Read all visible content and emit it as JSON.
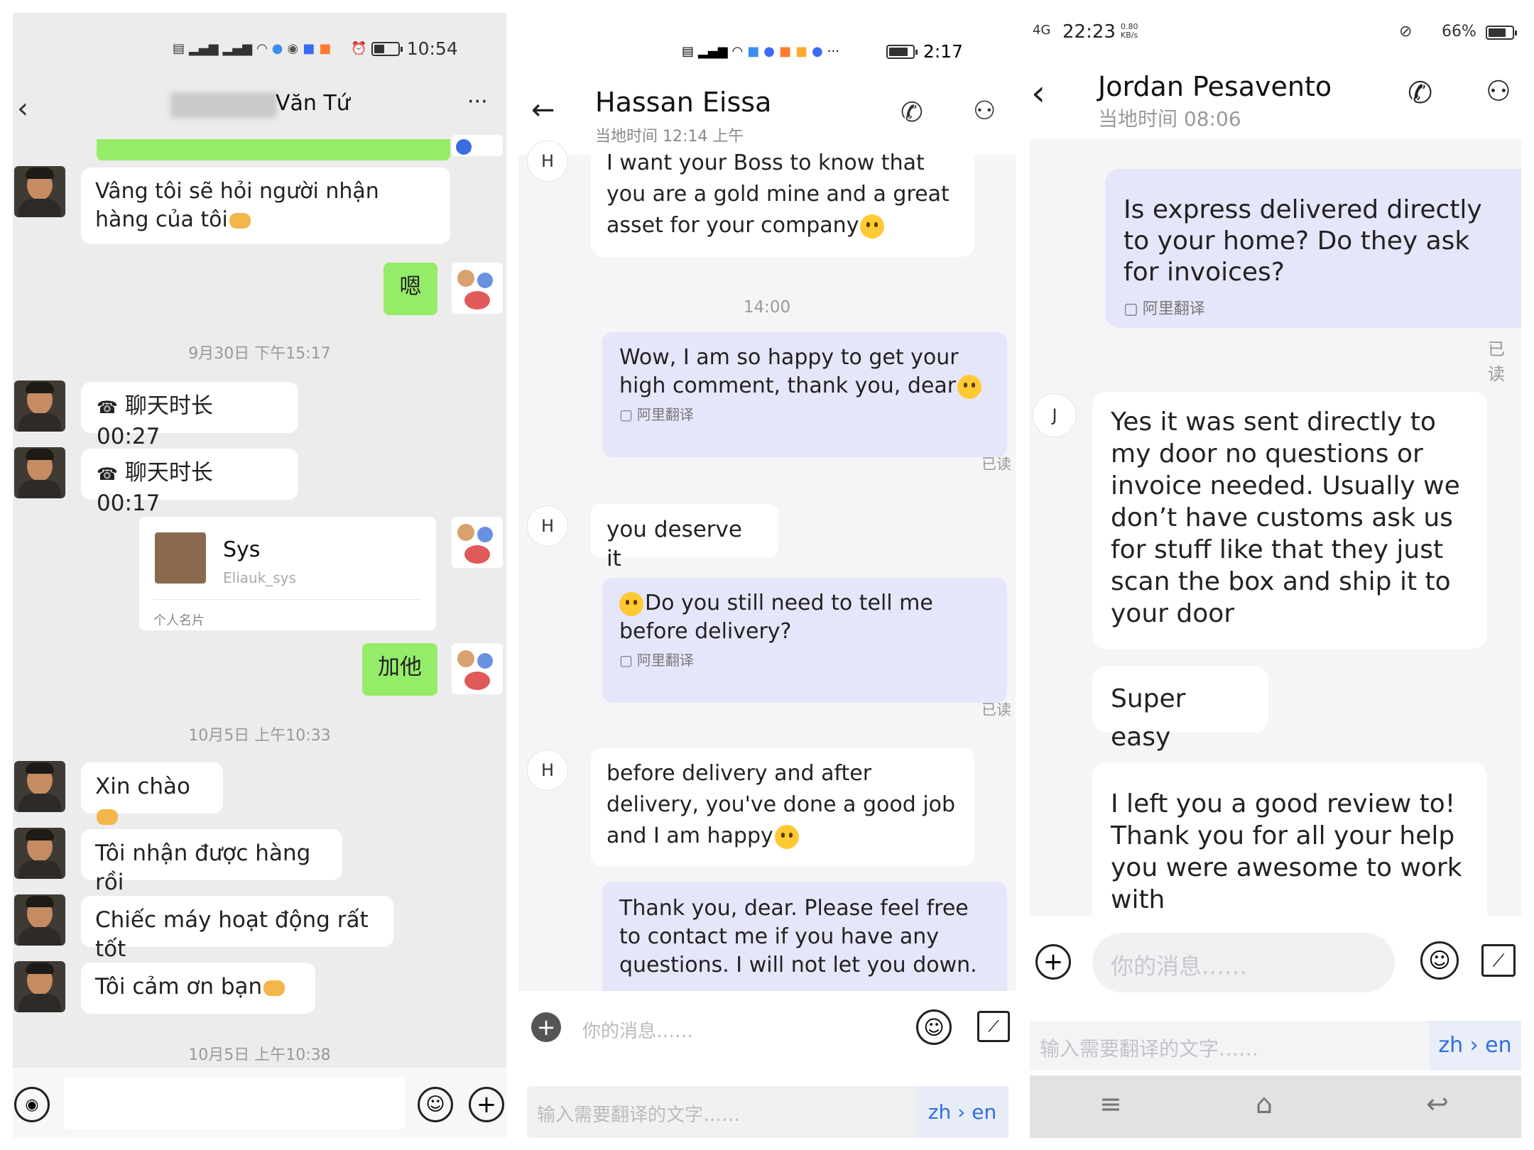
{
  "panel1": {
    "status": {
      "time": "10:54"
    },
    "header": {
      "contact_name": "Văn Tứ",
      "more": "···"
    },
    "messages": {
      "m1": "Vâng tôi sẽ hỏi người nhận hàng của tôi",
      "m2": "嗯",
      "ts1": "9月30日 下午15:17",
      "call1": "聊天时长 00:27",
      "call2": "聊天时长 00:17",
      "card_name": "Sys",
      "card_id": "Eliauk_sys",
      "card_label": "个人名片",
      "m3": "加他",
      "ts2": "10月5日 上午10:33",
      "m4": "Xin chào",
      "m5": "Tôi nhận được hàng rồi",
      "m6": "Chiếc máy hoạt động rất tốt",
      "m7": "Tôi cảm ơn bạn",
      "ts3": "10月5日 上午10:38"
    }
  },
  "panel2": {
    "status": {
      "time": "2:17"
    },
    "header": {
      "name": "Hassan Eissa",
      "local_time": "当地时间 12:14 上午"
    },
    "messages": {
      "m1": "I want your Boss to know that you are a gold mine and a great asset for your company",
      "ts1": "14:00",
      "m2": "Wow, I am so happy to get your high comment, thank you, dear",
      "translate_label": "阿里翻译",
      "read": "已读",
      "m3": "you deserve it",
      "m4": "Do you still need to tell me before delivery?",
      "m5": "before delivery and after delivery, you've done a good job and I am happy",
      "m6": "Thank you, dear. Please feel free to contact me if you have any questions. I will not let you down.",
      "avatar_letter": "H"
    },
    "input": {
      "placeholder": "你的消息……",
      "translate_placeholder": "输入需要翻译的文字……",
      "lang": "zh › en"
    }
  },
  "panel3": {
    "status": {
      "time": "22:23",
      "speed": "0.80 KB/s",
      "battery": "66%",
      "network": "4G"
    },
    "header": {
      "name": "Jordan Pesavento",
      "local_time": "当地时间 08:06"
    },
    "messages": {
      "m1": "Is express delivered directly to your home? Do they ask for invoices?",
      "translate_label": "阿里翻译",
      "read": "已读",
      "avatar_letter": "J",
      "m2": "Yes it was sent directly to my door no questions or invoice needed. Usually we don’t have customs ask us for stuff like that they just scan the box and ship it to your door",
      "m3": "Super easy",
      "m4": "I left you a good review to! Thank you for all your help you were awesome to work with"
    },
    "input": {
      "placeholder": "你的消息……",
      "translate_placeholder": "输入需要翻译的文字……",
      "lang": "zh › en"
    }
  },
  "colors": {
    "wechat_green": "#95ec69",
    "purple_bubble": "#e6e6fa",
    "blue_lang": "#2f6fe0"
  }
}
